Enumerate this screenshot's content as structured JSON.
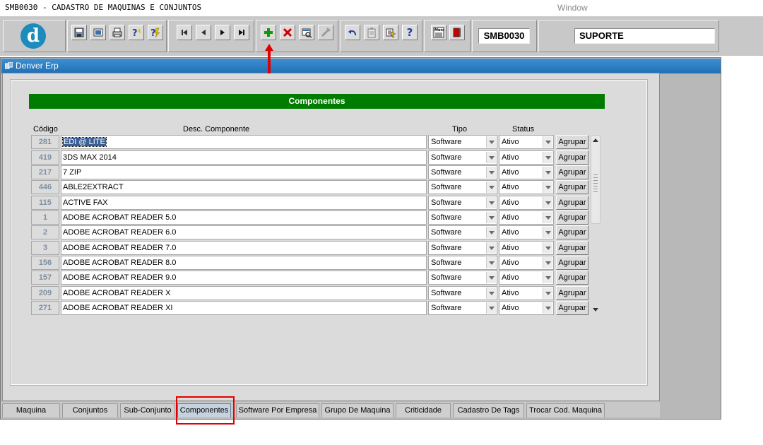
{
  "titlebar": {
    "app_title": "SMB0030 - CADASTRO DE MAQUINAS E CONJUNTOS",
    "window_menu": "Window"
  },
  "toolbar": {
    "logo_letter": "d",
    "form_code": "SMB0030",
    "user": "SUPORTE",
    "icons": [
      "save-icon",
      "print-preview-icon",
      "print-icon",
      "query-icon",
      "execute-query-icon",
      "first-record-icon",
      "previous-record-icon",
      "next-record-icon",
      "last-record-icon",
      "insert-record-icon",
      "delete-record-icon",
      "duplicate-record-icon",
      "clear-record-icon",
      "undo-icon",
      "paste-icon",
      "list-values-icon",
      "help-icon",
      "menu-icon",
      "exit-icon"
    ],
    "help_glyph": "?",
    "menu_glyph": "Menu"
  },
  "frame": {
    "title": "Denver Erp"
  },
  "block": {
    "header": "Componentes",
    "columns": {
      "code": "Código",
      "desc": "Desc. Componente",
      "tipo": "Tipo",
      "status": "Status"
    },
    "button_label": "Agrupar",
    "rows": [
      {
        "code": "281",
        "desc": "EDI @ LITE",
        "tipo": "Software",
        "status": "Ativo"
      },
      {
        "code": "419",
        "desc": "3DS MAX 2014",
        "tipo": "Software",
        "status": "Ativo"
      },
      {
        "code": "217",
        "desc": "7 ZIP",
        "tipo": "Software",
        "status": "Ativo"
      },
      {
        "code": "446",
        "desc": "ABLE2EXTRACT",
        "tipo": "Software",
        "status": "Ativo"
      },
      {
        "code": "115",
        "desc": "ACTIVE FAX",
        "tipo": "Software",
        "status": "Ativo"
      },
      {
        "code": "1",
        "desc": "ADOBE ACROBAT READER 5.0",
        "tipo": "Software",
        "status": "Ativo"
      },
      {
        "code": "2",
        "desc": "ADOBE ACROBAT READER 6.0",
        "tipo": "Software",
        "status": "Ativo"
      },
      {
        "code": "3",
        "desc": "ADOBE ACROBAT READER 7.0",
        "tipo": "Software",
        "status": "Ativo"
      },
      {
        "code": "156",
        "desc": "ADOBE ACROBAT READER 8.0",
        "tipo": "Software",
        "status": "Ativo"
      },
      {
        "code": "157",
        "desc": "ADOBE ACROBAT READER 9.0",
        "tipo": "Software",
        "status": "Ativo"
      },
      {
        "code": "209",
        "desc": "ADOBE ACROBAT READER X",
        "tipo": "Software",
        "status": "Ativo"
      },
      {
        "code": "271",
        "desc": "ADOBE ACROBAT READER XI",
        "tipo": "Software",
        "status": "Ativo"
      }
    ]
  },
  "tabs": [
    {
      "label": "Maquina"
    },
    {
      "label": "Conjuntos"
    },
    {
      "label": "Sub-Conjunto"
    },
    {
      "label": "Componentes",
      "active": true
    },
    {
      "label": "Software Por Empresa"
    },
    {
      "label": "Grupo De Maquina"
    },
    {
      "label": "Criticidade"
    },
    {
      "label": "Cadastro De Tags"
    },
    {
      "label": "Trocar Cod. Maquina"
    }
  ],
  "colors": {
    "header_green": "#007d00",
    "title_blue": "#2b7cc4",
    "highlight_red": "#e00000",
    "logo_blue": "#1b8cbc"
  }
}
